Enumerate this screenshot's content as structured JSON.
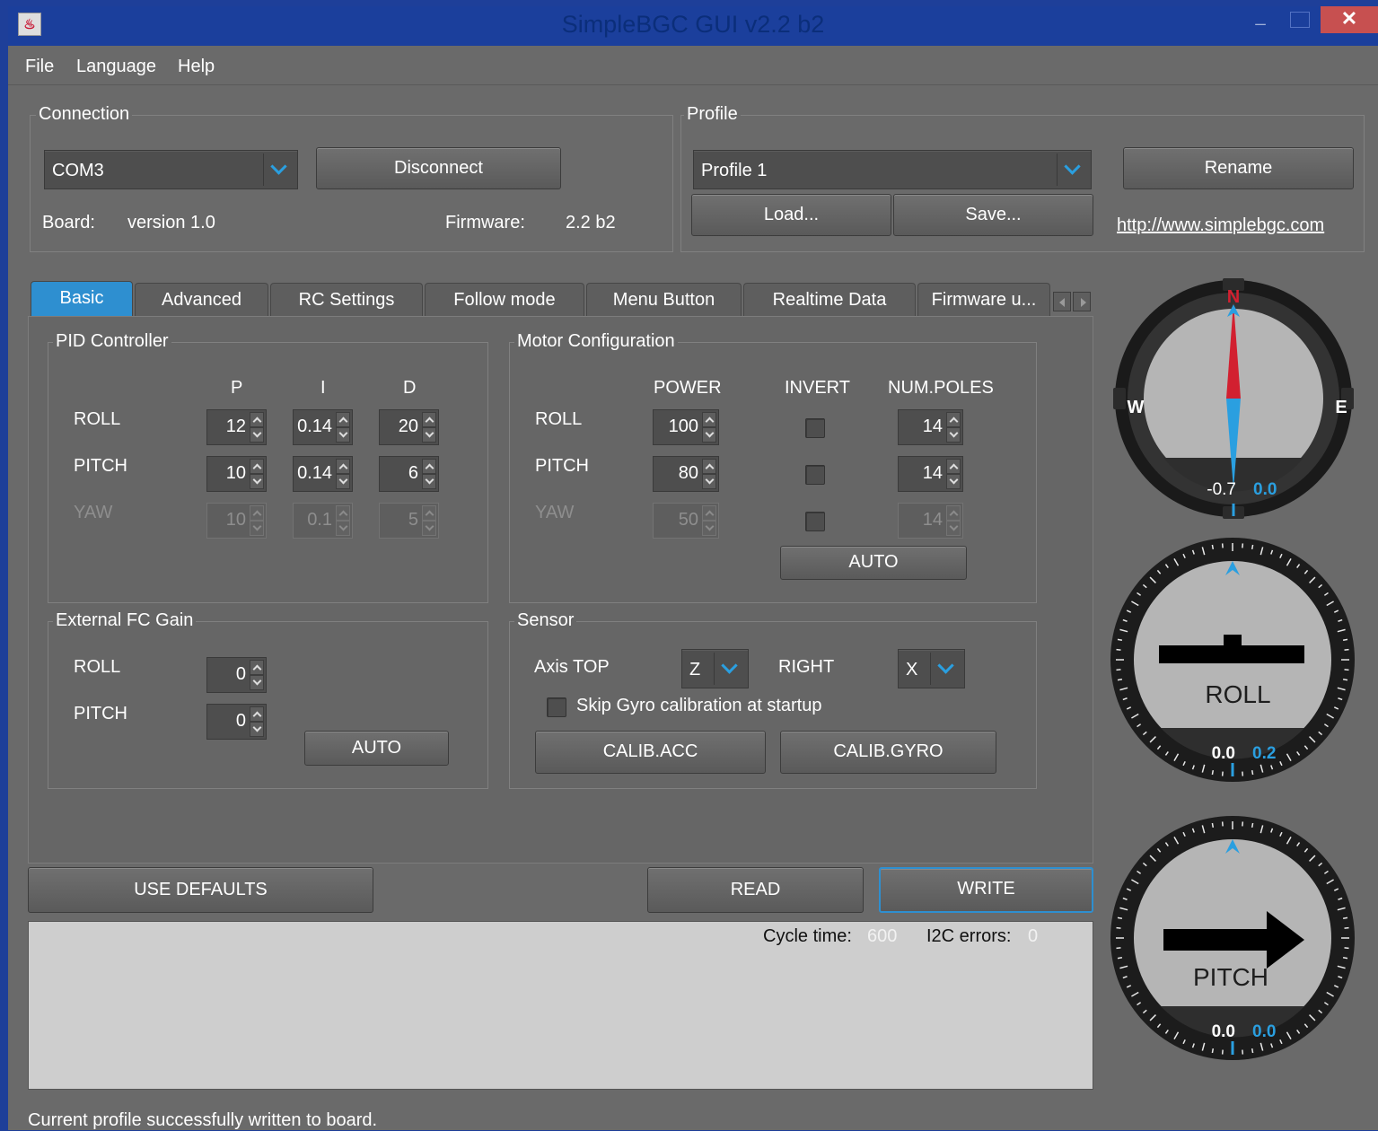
{
  "window": {
    "title": "SimpleBGC GUI v2.2 b2",
    "app_icon": "java-icon",
    "close_glyph": "✕"
  },
  "menu": [
    "File",
    "Language",
    "Help"
  ],
  "connection": {
    "title": "Connection",
    "port": "COM3",
    "disconnect": "Disconnect",
    "board_label": "Board:",
    "board_value": "version 1.0",
    "firmware_label": "Firmware:",
    "firmware_value": "2.2 b2"
  },
  "profile": {
    "title": "Profile",
    "selected": "Profile 1",
    "load": "Load...",
    "save": "Save...",
    "rename": "Rename",
    "link": "http://www.simplebgc.com"
  },
  "tabs": [
    "Basic",
    "Advanced",
    "RC Settings",
    "Follow mode",
    "Menu Button",
    "Realtime Data",
    "Firmware u..."
  ],
  "pid": {
    "title": "PID Controller",
    "headers": [
      "P",
      "I",
      "D"
    ],
    "rows": [
      {
        "label": "ROLL",
        "p": "12",
        "i": "0.14",
        "d": "20"
      },
      {
        "label": "PITCH",
        "p": "10",
        "i": "0.14",
        "d": "6"
      },
      {
        "label": "YAW",
        "p": "10",
        "i": "0.1",
        "d": "5"
      }
    ]
  },
  "motor": {
    "title": "Motor Configuration",
    "headers": [
      "POWER",
      "INVERT",
      "NUM.POLES"
    ],
    "rows": [
      {
        "label": "ROLL",
        "power": "100",
        "poles": "14"
      },
      {
        "label": "PITCH",
        "power": "80",
        "poles": "14"
      },
      {
        "label": "YAW",
        "power": "50",
        "poles": "14"
      }
    ],
    "auto": "AUTO"
  },
  "fc": {
    "title": "External FC Gain",
    "roll_label": "ROLL",
    "roll": "0",
    "pitch_label": "PITCH",
    "pitch": "0",
    "auto": "AUTO"
  },
  "sensor": {
    "title": "Sensor",
    "axis_top_label": "Axis TOP",
    "axis_top": "Z",
    "right_label": "RIGHT",
    "right": "X",
    "skip_gyro": "Skip Gyro calibration at startup",
    "calib_acc": "CALIB.ACC",
    "calib_gyro": "CALIB.GYRO"
  },
  "actions": {
    "defaults": "USE DEFAULTS",
    "read": "READ",
    "write": "WRITE"
  },
  "log": {
    "cycle_label": "Cycle time:",
    "cycle": "600",
    "i2c_label": "I2C errors:",
    "i2c": "0"
  },
  "status": "Current profile successfully written to board.",
  "gauges": {
    "compass": {
      "n": "N",
      "e": "E",
      "w": "W",
      "value": "-0.7",
      "rate": "0.0"
    },
    "roll": {
      "label": "ROLL",
      "value": "0.0",
      "rate": "0.2"
    },
    "pitch": {
      "label": "PITCH",
      "value": "0.0",
      "rate": "0.0"
    }
  },
  "colors": {
    "accent": "#2e8fd0",
    "title_bar": "#1b3f9c",
    "close": "#c75050",
    "needle_red": "#d22030",
    "needle_blue": "#2a9fe0"
  }
}
